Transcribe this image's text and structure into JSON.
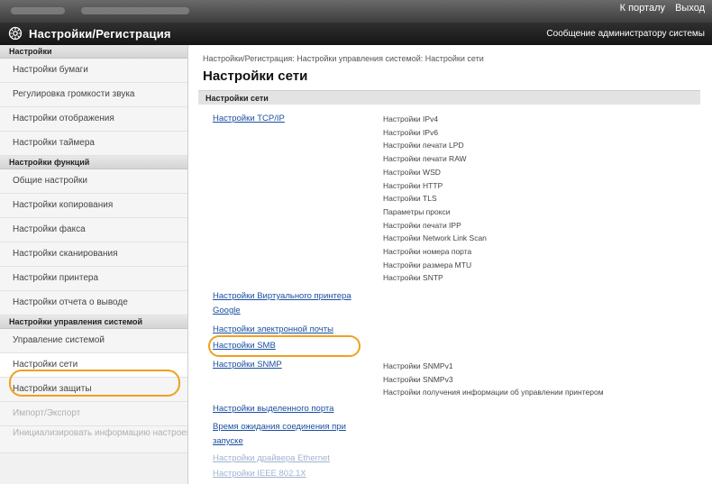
{
  "topbar": {
    "to_portal": "К порталу",
    "logout": "Выход"
  },
  "header": {
    "title": "Настройки/Регистрация",
    "admin_message": "Сообщение администратору системы"
  },
  "sidebar": {
    "sections": [
      {
        "heading": "Настройки",
        "items": [
          {
            "label": "Настройки бумаги"
          },
          {
            "label": "Регулировка громкости звука"
          },
          {
            "label": "Настройки отображения"
          },
          {
            "label": "Настройки таймера"
          }
        ]
      },
      {
        "heading": "Настройки функций",
        "items": [
          {
            "label": "Общие настройки"
          },
          {
            "label": "Настройки копирования"
          },
          {
            "label": "Настройки факса"
          },
          {
            "label": "Настройки сканирования"
          },
          {
            "label": "Настройки принтера"
          },
          {
            "label": "Настройки отчета о выводе"
          }
        ]
      },
      {
        "heading": "Настройки управления системой",
        "items": [
          {
            "label": "Управление системой"
          },
          {
            "label": "Настройки сети"
          },
          {
            "label": "Настройки защиты"
          },
          {
            "label": "Импорт/Экспорт"
          },
          {
            "label": "Инициализировать информацию настроек"
          }
        ]
      }
    ]
  },
  "main": {
    "breadcrumb": "Настройки/Регистрация: Настройки управления системой: Настройки сети",
    "title": "Настройки сети",
    "section": "Настройки сети",
    "tcpip": {
      "link": "Настройки TCP/IP",
      "values": [
        "Настройки IPv4",
        "Настройки IPv6",
        "Настройки печати LPD",
        "Настройки печати RAW",
        "Настройки WSD",
        "Настройки HTTP",
        "Настройки TLS",
        "Параметры прокси",
        "Настройки печати IPP",
        "Настройки Network Link Scan",
        "Настройки номера порта",
        "Настройки размера MTU",
        "Настройки SNTP"
      ]
    },
    "google_link": "Настройки Виртуального принтера Google",
    "email_link": "Настройки электронной почты",
    "smb_link": "Настройки SMB",
    "snmp": {
      "link": "Настройки SNMP",
      "values": [
        "Настройки SNMPv1",
        "Настройки SNMPv3",
        "Настройки получения информации об управлении принтером"
      ]
    },
    "dedicated_port_link": "Настройки выделенного порта",
    "wait_link": "Время ожидания соединения при запуске",
    "ethernet_link": "Настройки драйвера Ethernet",
    "ieee_link": "Настройки IEEE 802.1X"
  },
  "colors": {
    "highlight": "#f0a020",
    "link": "#1a4fa0"
  }
}
